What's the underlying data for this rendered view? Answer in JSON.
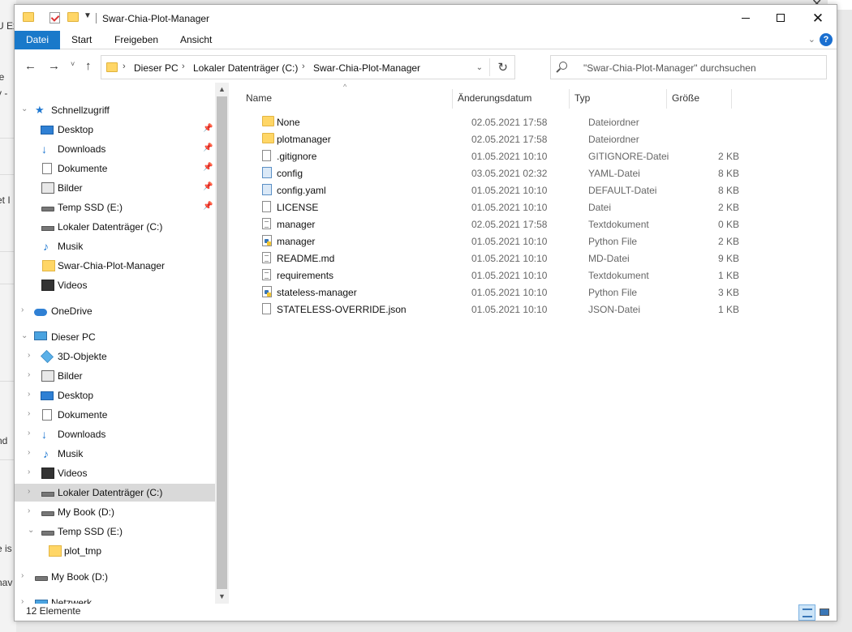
{
  "background": {
    "fragments": [
      "ie",
      "y -",
      "et I",
      "nd",
      "e is",
      "nav",
      "U Ex"
    ]
  },
  "window": {
    "title": "Swar-Chia-Plot-Manager"
  },
  "ribbon": {
    "tabs": [
      "Datei",
      "Start",
      "Freigeben",
      "Ansicht"
    ],
    "help": "?"
  },
  "navigation": {
    "back": "←",
    "forward": "→",
    "recent": "˅",
    "up": "↑",
    "refresh": "↻"
  },
  "address": {
    "breadcrumbs": [
      "Dieser PC",
      "Lokaler Datenträger (C:)",
      "Swar-Chia-Plot-Manager"
    ]
  },
  "search": {
    "placeholder": "\"Swar-Chia-Plot-Manager\" durchsuchen"
  },
  "tree": [
    {
      "label": "Schnellzugriff",
      "icon": "star-icon",
      "expanded": true,
      "pinned": false
    },
    {
      "label": "Desktop",
      "icon": "desktop-icon",
      "pinned": true
    },
    {
      "label": "Downloads",
      "icon": "download-icon",
      "pinned": true
    },
    {
      "label": "Dokumente",
      "icon": "document-icon",
      "pinned": true
    },
    {
      "label": "Bilder",
      "icon": "pictures-icon",
      "pinned": true
    },
    {
      "label": "Temp SSD (E:)",
      "icon": "drive-icon",
      "pinned": true
    },
    {
      "label": "Lokaler Datenträger (C:)",
      "icon": "drive-icon",
      "pinned": false
    },
    {
      "label": "Musik",
      "icon": "music-icon",
      "pinned": false
    },
    {
      "label": "Swar-Chia-Plot-Manager",
      "icon": "folder-icon",
      "pinned": false
    },
    {
      "label": "Videos",
      "icon": "video-icon",
      "pinned": false
    },
    {
      "label": "OneDrive",
      "icon": "cloud-icon",
      "expanded": false
    },
    {
      "label": "Dieser PC",
      "icon": "pc-icon",
      "expanded": true
    },
    {
      "label": "3D-Objekte",
      "icon": "objects-3d-icon",
      "expanded": false
    },
    {
      "label": "Bilder",
      "icon": "pictures-icon",
      "expanded": false
    },
    {
      "label": "Desktop",
      "icon": "desktop-icon",
      "expanded": false
    },
    {
      "label": "Dokumente",
      "icon": "document-icon",
      "expanded": false
    },
    {
      "label": "Downloads",
      "icon": "download-icon",
      "expanded": false
    },
    {
      "label": "Musik",
      "icon": "music-icon",
      "expanded": false
    },
    {
      "label": "Videos",
      "icon": "video-icon",
      "expanded": false
    },
    {
      "label": "Lokaler Datenträger (C:)",
      "icon": "drive-icon",
      "expanded": false,
      "selected": true
    },
    {
      "label": "My Book (D:)",
      "icon": "drive-icon",
      "expanded": false
    },
    {
      "label": "Temp SSD (E:)",
      "icon": "drive-icon",
      "expanded": true
    },
    {
      "label": "plot_tmp",
      "icon": "folder-icon"
    },
    {
      "label": "My Book (D:)",
      "icon": "drive-icon",
      "expanded": false
    },
    {
      "label": "Netzwerk",
      "icon": "network-icon",
      "expanded": false
    }
  ],
  "columns": [
    "Name",
    "Änderungsdatum",
    "Typ",
    "Größe"
  ],
  "files": [
    {
      "name": "None",
      "date": "02.05.2021 17:58",
      "type": "Dateiordner",
      "size": "",
      "icon": "folder-icon"
    },
    {
      "name": "plotmanager",
      "date": "02.05.2021 17:58",
      "type": "Dateiordner",
      "size": "",
      "icon": "folder-icon"
    },
    {
      "name": ".gitignore",
      "date": "01.05.2021 10:10",
      "type": "GITIGNORE-Datei",
      "size": "2 KB",
      "icon": "file-icon"
    },
    {
      "name": "config",
      "date": "03.05.2021 02:32",
      "type": "YAML-Datei",
      "size": "8 KB",
      "icon": "config-file-icon"
    },
    {
      "name": "config.yaml",
      "date": "01.05.2021 10:10",
      "type": "DEFAULT-Datei",
      "size": "8 KB",
      "icon": "config-file-icon"
    },
    {
      "name": "LICENSE",
      "date": "01.05.2021 10:10",
      "type": "Datei",
      "size": "2 KB",
      "icon": "file-icon"
    },
    {
      "name": "manager",
      "date": "02.05.2021 17:58",
      "type": "Textdokument",
      "size": "0 KB",
      "icon": "text-file-icon"
    },
    {
      "name": "manager",
      "date": "01.05.2021 10:10",
      "type": "Python File",
      "size": "2 KB",
      "icon": "python-file-icon"
    },
    {
      "name": "README.md",
      "date": "01.05.2021 10:10",
      "type": "MD-Datei",
      "size": "9 KB",
      "icon": "text-file-icon"
    },
    {
      "name": "requirements",
      "date": "01.05.2021 10:10",
      "type": "Textdokument",
      "size": "1 KB",
      "icon": "text-file-icon"
    },
    {
      "name": "stateless-manager",
      "date": "01.05.2021 10:10",
      "type": "Python File",
      "size": "3 KB",
      "icon": "python-file-icon"
    },
    {
      "name": "STATELESS-OVERRIDE.json",
      "date": "01.05.2021 10:10",
      "type": "JSON-Datei",
      "size": "1 KB",
      "icon": "file-icon"
    }
  ],
  "status": {
    "item_count": "12 Elemente"
  }
}
